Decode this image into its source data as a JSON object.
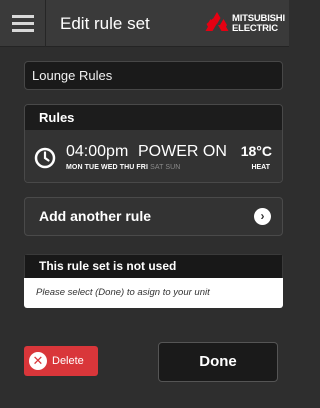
{
  "header": {
    "title": "Edit rule set",
    "menu_icon": "hamburger-menu-icon",
    "logo": {
      "line1": "MITSUBISHI",
      "line2": "ELECTRIC",
      "color": "#e60012"
    }
  },
  "rule_set_name": {
    "value": "Lounge Rules"
  },
  "rules": {
    "heading": "Rules",
    "items": [
      {
        "time": "04:00pm",
        "action": "POWER ON",
        "active_days": "MON TUE WED THU FRI",
        "inactive_days": "SAT SUN",
        "temperature": "18°C",
        "mode": "HEAT",
        "icon": "clock-icon"
      }
    ]
  },
  "add_rule": {
    "label": "Add another rule",
    "icon": "chevron-right-icon"
  },
  "notice": {
    "heading": "This rule set is not used",
    "message": "Please select (Done) to asign to your unit"
  },
  "actions": {
    "delete_label": "Delete",
    "delete_icon": "close-icon",
    "delete_color": "#d9363a",
    "done_label": "Done"
  }
}
